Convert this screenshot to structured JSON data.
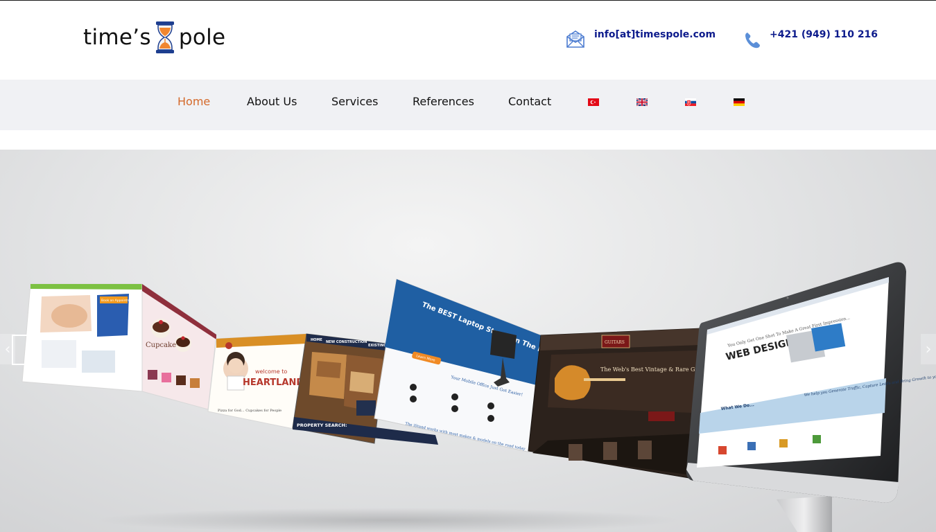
{
  "brand": {
    "logo_text_left": "time’s",
    "logo_text_right": "pole"
  },
  "contact": {
    "email": "info[at]timespole.com",
    "phone": "+421 (949) 110 216"
  },
  "nav": {
    "items": [
      {
        "label": "Home",
        "active": true
      },
      {
        "label": "About Us",
        "active": false
      },
      {
        "label": "Services",
        "active": false
      },
      {
        "label": "References",
        "active": false
      },
      {
        "label": "Contact",
        "active": false
      }
    ],
    "languages": [
      "turkish-flag-icon",
      "uk-flag-icon",
      "slovak-flag-icon",
      "german-flag-icon"
    ]
  },
  "hero": {
    "slides_text": {
      "spa_button": "Book an Appointment",
      "cupcake": "Cupcake",
      "heartland_small": "welcome to",
      "heartland_big": "HEARTLAND",
      "heartland_tag": "Pizza for God... Cupcakes for People",
      "realty_nav": [
        "HOME",
        "NEW CONSTRUCTION",
        "EXISTING"
      ],
      "realty_search": "PROPERTY SEARCH:",
      "laptop_title": "The BEST Laptop Stand On The Market.",
      "laptop_sub": "Your Mobile Office Just Got Easier!",
      "laptop_btn": "Learn More",
      "laptop_footer": "The iStand works with most makes & models on the road today",
      "guitar_brand": "GUITARS",
      "guitar_title": "The Web's Best Vintage & Rare Guitars",
      "monitor_headline": "You Only Get One Shot To Make A Great First Impression...",
      "monitor_title": "WEB DESIGN",
      "monitor_quote": "We help you Generate Traffic, Capture Leads and Bring Growth to your Business.",
      "monitor_whatwedo": "What We Do..."
    }
  },
  "colors": {
    "nav_active": "#d4692a",
    "contact_text": "#0d1b8c",
    "nav_bg": "#f0f1f4"
  }
}
